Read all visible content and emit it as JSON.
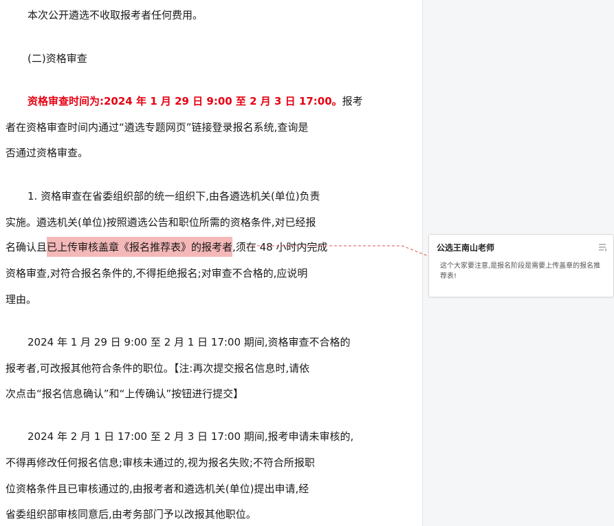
{
  "document": {
    "p1": "本次公开遴选不收取报考者任何费用。",
    "p2": "(二)资格审查",
    "p3": {
      "red": "资格审查时间为:2024 年 1 月 29 日 9:00 至 2 月 3 日 17:00。",
      "l1_rest": "报考",
      "l2": "者在资格审查时间内通过“遴选专题网页”链接登录报名系统,查询是",
      "l3": "否通过资格审查。"
    },
    "p4": {
      "l1": "1. 资格审查在省委组织部的统一组织下,由各遴选机关(单位)负责",
      "l2": "实施。遴选机关(单位)按照遴选公告和职位所需的资格条件,对已经报",
      "l3_pre": "名确认且",
      "l3_highlight": "已上传审核盖章《报名推荐表》的报考者",
      "l3_post": ",须在 48 小时内完成",
      "l4": "资格审查,对符合报名条件的,不得拒绝报名;对审查不合格的,应说明",
      "l5": "理由。"
    },
    "p5": {
      "l1": "2024 年 1 月 29 日 9:00 至 2 月 1 日 17:00 期间,资格审查不合格的",
      "l2": "报考者,可改报其他符合条件的职位。【注:再次提交报名信息时,请依",
      "l3": "次点击“报名信息确认”和“上传确认”按钮进行提交】"
    },
    "p6": {
      "l1": "2024 年 2 月 1 日 17:00 至 2 月 3 日 17:00 期间,报考申请未审核的,",
      "l2": "不得再修改任何报名信息;审核未通过的,视为报名失败;不符合所报职",
      "l3": "位资格条件且已审核通过的,由报考者和遴选机关(单位)提出申请,经",
      "l4": "省委组织部审核同意后,由考务部门予以改报其他职位。"
    }
  },
  "comment": {
    "author": "公选王南山老师",
    "text": "这个大家要注意,是报名阶段是需要上传盖章的报名推荐表!",
    "menu_icon": "list-menu-icon"
  },
  "colors": {
    "red_text": "#e60012",
    "highlight": "#f4b8b8",
    "comment_connector": "#e05050"
  }
}
